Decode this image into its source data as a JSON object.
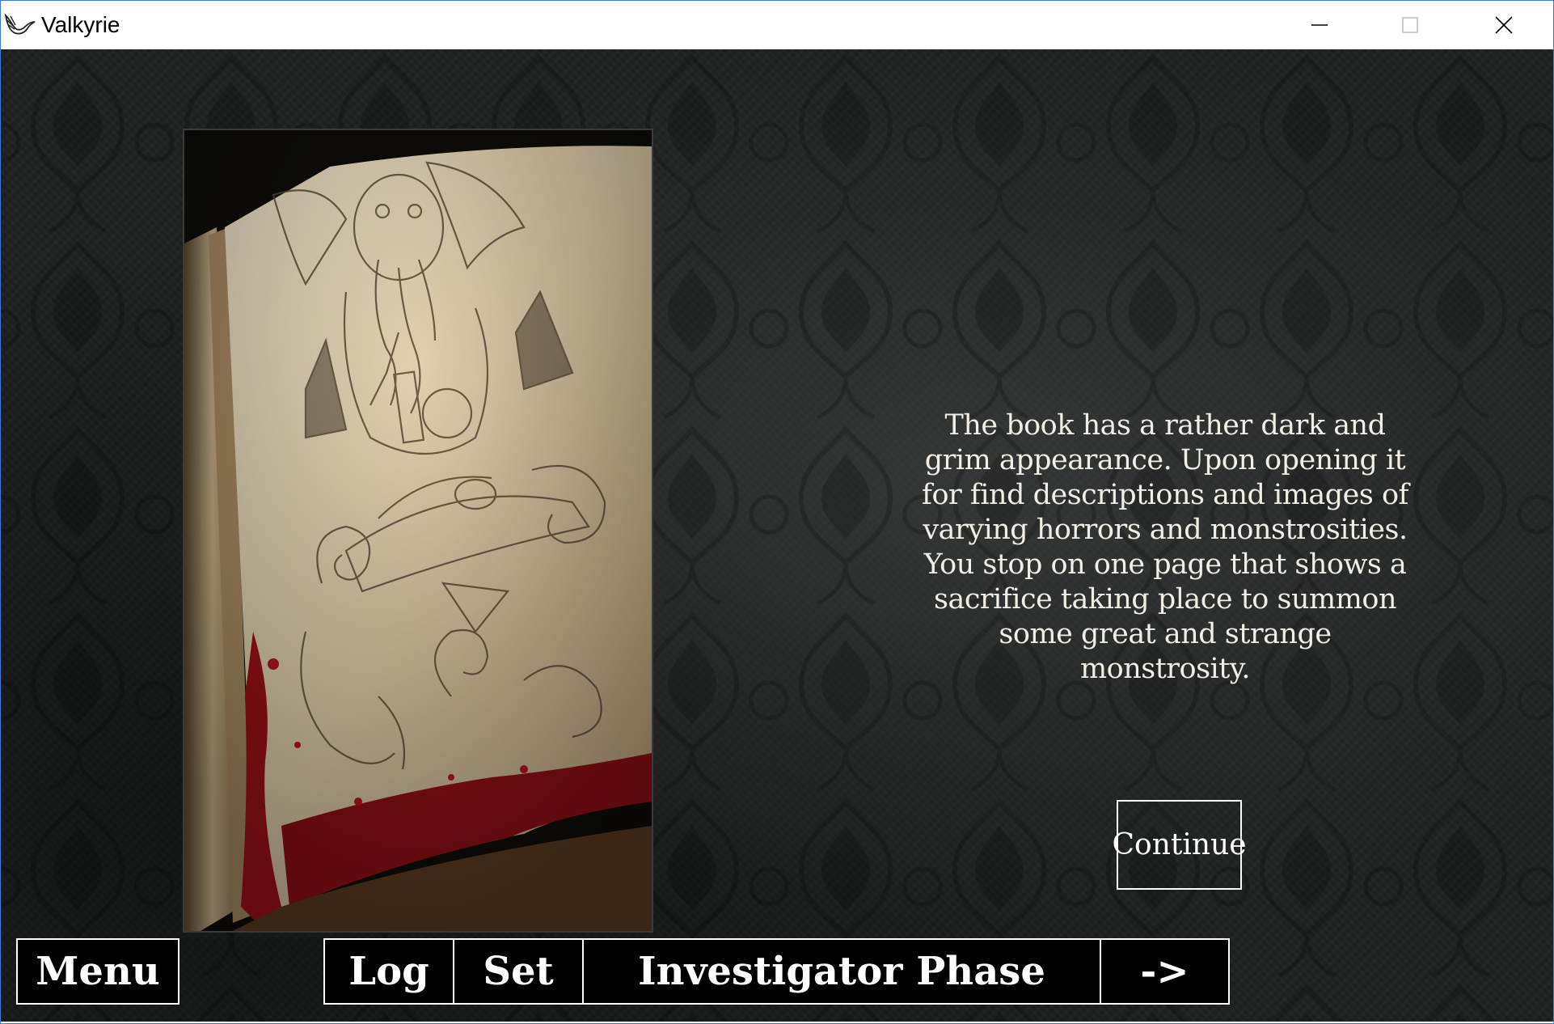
{
  "window": {
    "title": "Valkyrie",
    "controls": {
      "minimize": "minimize",
      "maximize": "maximize",
      "close": "close"
    }
  },
  "scene": {
    "image_alt": "book-illustration",
    "story_text": "The book has a rather dark and grim appearance. Upon opening it for find descriptions and images of varying horrors and monstrosities. You stop on one page that shows a sacrifice taking place to summon some great and strange monstrosity.",
    "continue_label": "Continue"
  },
  "bottom_bar": {
    "menu_label": "Menu",
    "log_label": "Log",
    "set_label": "Set",
    "phase_label": "Investigator Phase",
    "next_label": "->"
  },
  "colors": {
    "background": "#1e2120",
    "text": "#f1eee6",
    "button_border": "#ffffff",
    "button_fill": "#000000",
    "blood": "#a0141a",
    "parchment": "#e6d8bd"
  }
}
